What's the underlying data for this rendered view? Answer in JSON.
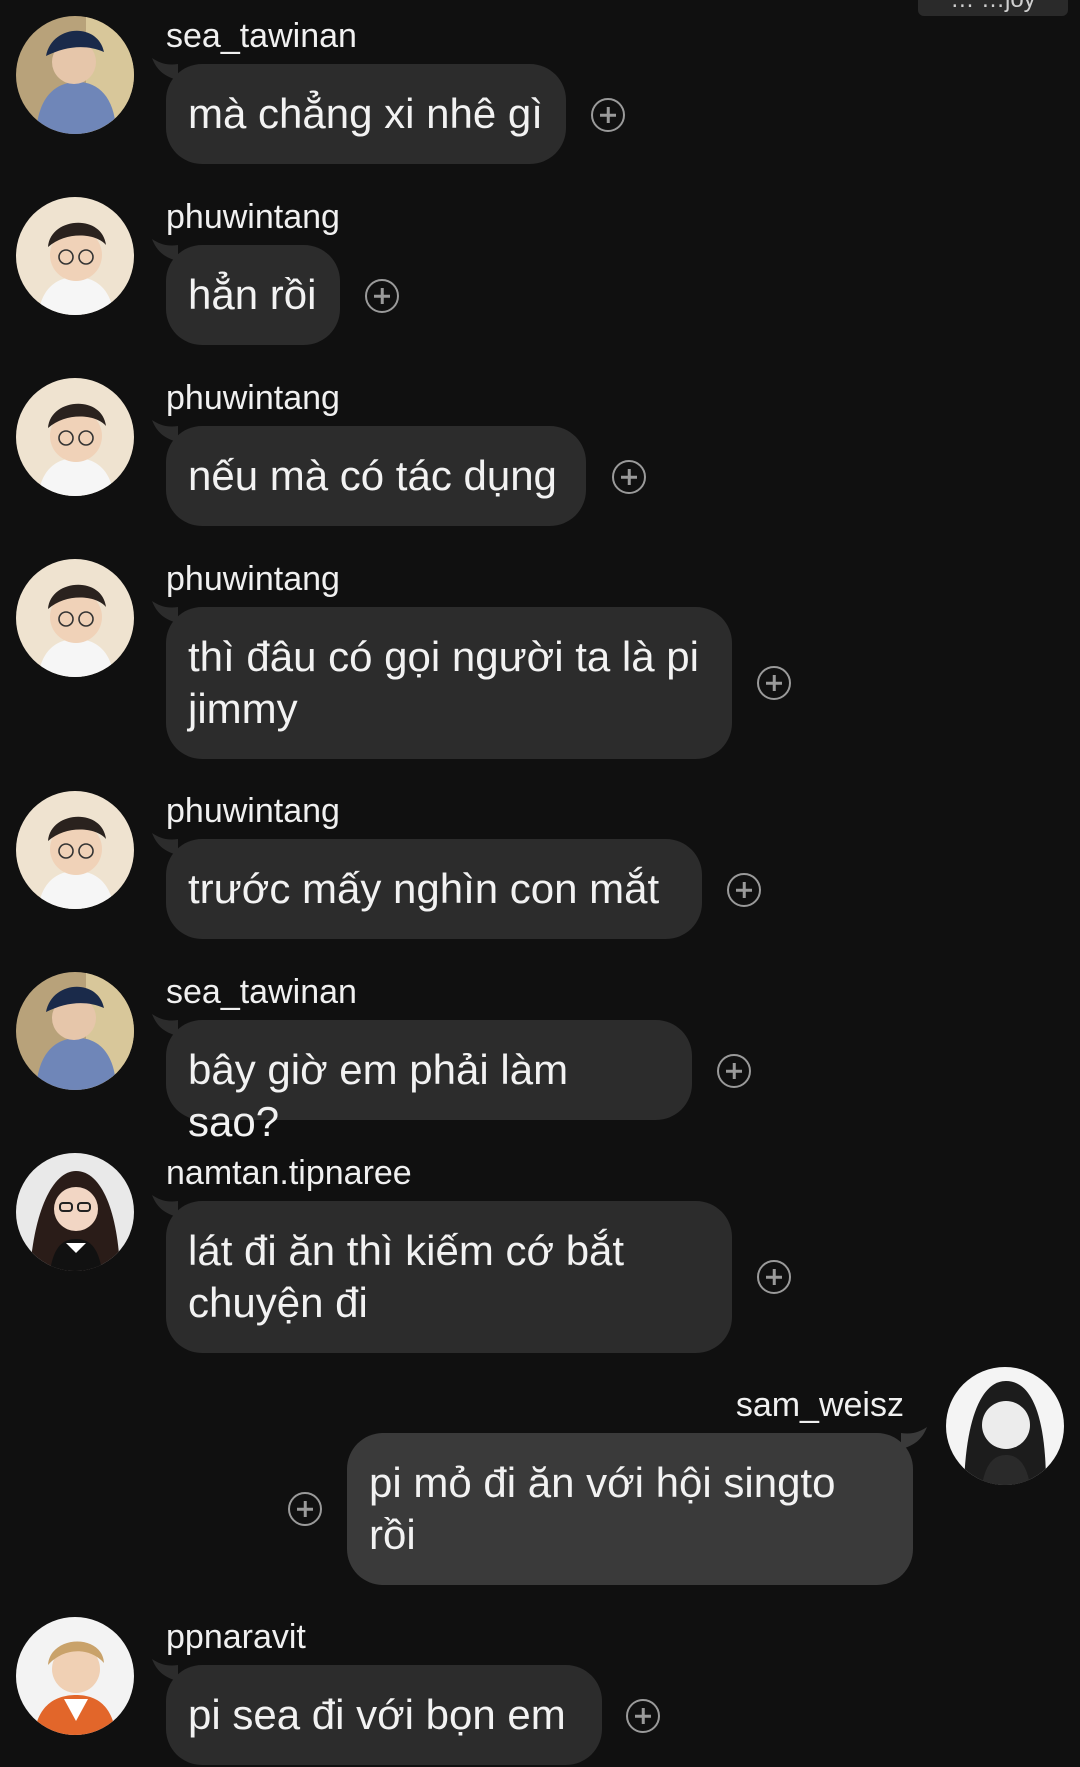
{
  "top_tag": "… …joy",
  "messages": [
    {
      "side": "left",
      "avatar": "sea_avatar",
      "username": "sea_tawinan",
      "text": "mà chẳng xi nhê gì"
    },
    {
      "side": "left",
      "avatar": "phuwin_avatar",
      "username": "phuwintang",
      "text": "hẳn rồi"
    },
    {
      "side": "left",
      "avatar": "phuwin_avatar",
      "username": "phuwintang",
      "text": "nếu mà có tác dụng"
    },
    {
      "side": "left",
      "avatar": "phuwin_avatar",
      "username": "phuwintang",
      "text": "thì đâu có gọi người ta là pi jimmy"
    },
    {
      "side": "left",
      "avatar": "phuwin_avatar",
      "username": "phuwintang",
      "text": "trước mấy nghìn con mắt"
    },
    {
      "side": "left",
      "avatar": "sea_avatar",
      "username": "sea_tawinan",
      "text": "bây giờ em phải làm sao?"
    },
    {
      "side": "left",
      "avatar": "namtan_avatar",
      "username": "namtan.tipnaree",
      "text": "lát đi ăn thì kiếm cớ bắt chuyện đi"
    },
    {
      "side": "right",
      "avatar": "sam_avatar",
      "username": "sam_weisz",
      "text": "pi mỏ đi ăn với hội singto rồi"
    },
    {
      "side": "left",
      "avatar": "pp_avatar",
      "username": "ppnaravit",
      "text": "pi sea đi với bọn em"
    }
  ],
  "colors": {
    "background": "#101010",
    "bubble_left": "#2c2c2c",
    "bubble_right": "#3a3a3a",
    "react_icon": "#9a9a9a"
  },
  "icons": {
    "react": "add-reaction-icon"
  }
}
